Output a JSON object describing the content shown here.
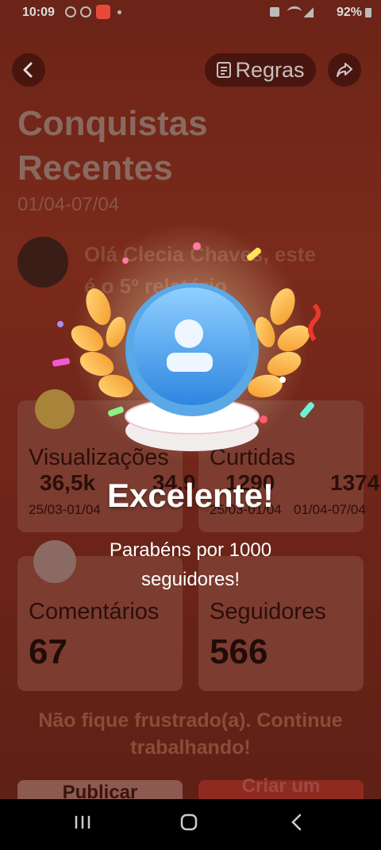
{
  "status_bar": {
    "time": "10:09",
    "battery": "92%"
  },
  "header": {
    "back_icon": "chevron-left-icon",
    "rules_label": "Regras",
    "share_icon": "share-icon"
  },
  "page": {
    "title_line1": "Conquistas",
    "title_line2": "Recentes",
    "date_range": "01/04-07/04",
    "greeting_line1": "Olá Clecia Chaves, este",
    "greeting_line2": "é o 5º relatório"
  },
  "stats": {
    "views": {
      "label": "Visualizações",
      "value": "36,5k",
      "prev_value": "34,9",
      "prev_date": "25/03-01/04"
    },
    "likes": {
      "label": "Curtidas",
      "value": "1290",
      "prev_value": "1374",
      "prev_date": "25/03-01/04",
      "cur_date": "01/04-07/04"
    },
    "comments": {
      "label": "Comentários",
      "value": "67"
    },
    "followers": {
      "label": "Seguidores",
      "value": "566"
    }
  },
  "hint": {
    "line1": "Não fique frustrado(a). Continue",
    "line2": "trabalhando!"
  },
  "bottom_buttons": {
    "publish": "Publicar",
    "create": "Criar um"
  },
  "overlay": {
    "title": "Excelente!",
    "subtitle": "Parabéns por 1000 seguidores!",
    "badge_icon": "user-badge-icon"
  },
  "colors": {
    "accent": "#e8392b",
    "badge_blue": "#4aa8f0",
    "laurel": "#f5b642"
  }
}
